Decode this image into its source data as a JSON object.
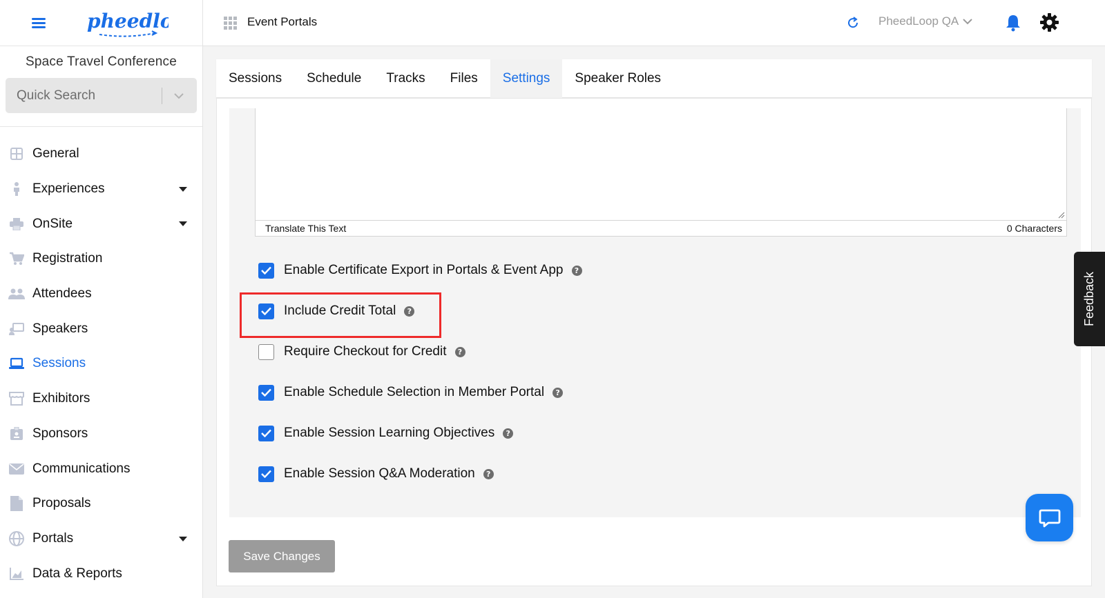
{
  "sidebar": {
    "conference_name": "Space Travel Conference",
    "quick_search_placeholder": "Quick Search",
    "items": [
      {
        "label": "General",
        "icon": "grid-icon",
        "has_caret": false,
        "active": false
      },
      {
        "label": "Experiences",
        "icon": "person-icon",
        "has_caret": true,
        "active": false
      },
      {
        "label": "OnSite",
        "icon": "printer-icon",
        "has_caret": true,
        "active": false
      },
      {
        "label": "Registration",
        "icon": "cart-icon",
        "has_caret": false,
        "active": false
      },
      {
        "label": "Attendees",
        "icon": "people-icon",
        "has_caret": false,
        "active": false
      },
      {
        "label": "Speakers",
        "icon": "presenter-icon",
        "has_caret": false,
        "active": false
      },
      {
        "label": "Sessions",
        "icon": "laptop-icon",
        "has_caret": false,
        "active": true
      },
      {
        "label": "Exhibitors",
        "icon": "storefront-icon",
        "has_caret": false,
        "active": false
      },
      {
        "label": "Sponsors",
        "icon": "badge-icon",
        "has_caret": false,
        "active": false
      },
      {
        "label": "Communications",
        "icon": "envelope-icon",
        "has_caret": false,
        "active": false
      },
      {
        "label": "Proposals",
        "icon": "document-icon",
        "has_caret": false,
        "active": false
      },
      {
        "label": "Portals",
        "icon": "globe-icon",
        "has_caret": true,
        "active": false
      },
      {
        "label": "Data & Reports",
        "icon": "bar-chart-icon",
        "has_caret": false,
        "active": false
      }
    ]
  },
  "topbar": {
    "title": "Event Portals",
    "org_name": "PheedLoop QA"
  },
  "tabs": [
    {
      "label": "Sessions",
      "active": false
    },
    {
      "label": "Schedule",
      "active": false
    },
    {
      "label": "Tracks",
      "active": false
    },
    {
      "label": "Files",
      "active": false
    },
    {
      "label": "Settings",
      "active": true
    },
    {
      "label": "Speaker Roles",
      "active": false
    }
  ],
  "editor": {
    "translate_label": "Translate This Text",
    "char_count": "0 Characters"
  },
  "options": [
    {
      "label": "Enable Certificate Export in Portals & Event App",
      "checked": true
    },
    {
      "label": "Include Credit Total",
      "checked": true
    },
    {
      "label": "Require Checkout for Credit",
      "checked": false
    },
    {
      "label": "Enable Schedule Selection in Member Portal",
      "checked": true
    },
    {
      "label": "Enable Session Learning Objectives",
      "checked": true
    },
    {
      "label": "Enable Session Q&A Moderation",
      "checked": true
    }
  ],
  "save_label": "Save Changes",
  "feedback_label": "Feedback",
  "colors": {
    "accent": "#1a6ee6",
    "highlight": "#ee2a2a",
    "save_disabled": "#9b9b9b"
  }
}
